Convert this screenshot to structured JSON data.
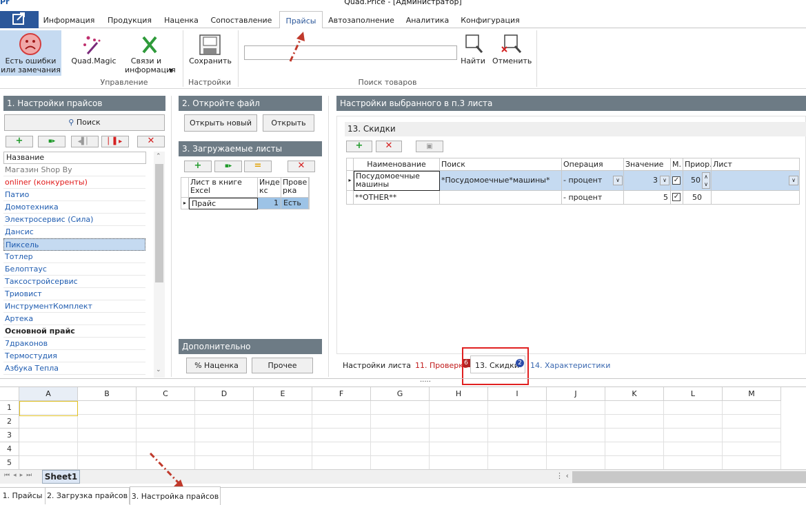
{
  "window": {
    "title": "Quad.Price - [Администратор]",
    "app_logo": "Pr"
  },
  "ribbon_tabs": [
    "Информация",
    "Продукция",
    "Наценка",
    "Сопоставление",
    "Прайсы",
    "Автозаполнение",
    "Аналитика",
    "Конфигурация"
  ],
  "ribbon_active_tab": "Прайсы",
  "ribbon": {
    "errors_button": "Есть ошибки или замечания",
    "quadmagic_button": "Quad.Magic",
    "links_button": "Связи и информация",
    "group_manage": "Управление",
    "save_button": "Сохранить",
    "group_settings": "Настройки",
    "search_value": "",
    "find_button": "Найти",
    "cancel_button": "Отменить",
    "group_search": "Поиск товаров"
  },
  "panel1": {
    "header": "1. Настройки прайсов",
    "search_button": "Поиск",
    "column_header": "Название",
    "items": [
      {
        "name": "Магазин Shop By",
        "style": "gray"
      },
      {
        "name": "onliner (конкуренты)",
        "style": "red"
      },
      {
        "name": "Патио",
        "style": "blue"
      },
      {
        "name": "Домотехника",
        "style": "blue"
      },
      {
        "name": "Электросервис (Сила)",
        "style": "blue"
      },
      {
        "name": "Дансис",
        "style": "blue"
      },
      {
        "name": "Пиксель",
        "style": "selected"
      },
      {
        "name": "Тотлер",
        "style": "blue"
      },
      {
        "name": "Белоптаус",
        "style": "blue"
      },
      {
        "name": "Таксостройсервис",
        "style": "blue"
      },
      {
        "name": "Триовист",
        "style": "blue"
      },
      {
        "name": "ИнструментКомплект",
        "style": "blue"
      },
      {
        "name": "Артека",
        "style": "blue"
      },
      {
        "name": "Основной прайс",
        "style": "bold"
      },
      {
        "name": "7драконов",
        "style": "blue"
      },
      {
        "name": "Термостудия",
        "style": "blue"
      },
      {
        "name": "Азбука Тепла",
        "style": "blue"
      }
    ]
  },
  "panel2": {
    "header": "2. Откройте файл",
    "open_new_button": "Открыть новый",
    "open_button": "Открыть"
  },
  "panel3": {
    "header": "3. Загружаемые листы",
    "columns": [
      "Лист в книге Excel",
      "Индекс",
      "Проверка"
    ],
    "column_labels_display": [
      "Лист в книге Excel",
      "Инде\nкс",
      "Прове\nрка"
    ],
    "rows": [
      {
        "sheet": "Прайс",
        "index": "1",
        "check": "Есть"
      }
    ]
  },
  "additional": {
    "header": "Дополнительно",
    "markup_button": "Наценка",
    "other_button": "Прочее"
  },
  "sheet_settings": {
    "header": "Настройки выбранного в п.3 листа",
    "discounts_header": "13. Скидки",
    "columns": [
      "Наименование",
      "Поиск",
      "Операция",
      "Значение",
      "М.",
      "Приор.",
      "Лист"
    ],
    "rows": [
      {
        "name": "Посудомоечные машины",
        "search": "*Посудомоечные*машины*",
        "operation": "- процент",
        "value": "3",
        "m": true,
        "priority": "50",
        "sheet": ""
      },
      {
        "name": "**OTHER**",
        "search": "",
        "operation": "- процент",
        "value": "5",
        "m": true,
        "priority": "50",
        "sheet": ""
      }
    ],
    "tabs": [
      {
        "label": "Настройки листа",
        "badge": ""
      },
      {
        "label": "11. Проверка",
        "badge": "6"
      },
      {
        "label": "13. Скидки",
        "badge": "2"
      },
      {
        "label": "14. Характеристики",
        "badge": ""
      }
    ],
    "active_tab": "13. Скидки"
  },
  "spreadsheet": {
    "columns": [
      "A",
      "B",
      "C",
      "D",
      "E",
      "F",
      "G",
      "H",
      "I",
      "J",
      "K",
      "L",
      "M"
    ],
    "rows": [
      "1",
      "2",
      "3",
      "4",
      "5"
    ],
    "sheet_tab": "Sheet1",
    "splitter": "....."
  },
  "bottom_tabs": [
    "1. Прайсы",
    "2. Загрузка прайсов",
    "3. Настройка прайсов"
  ],
  "bottom_active_tab": "3. Настройка прайсов",
  "colors": {
    "accent": "#2b579a",
    "panel_header": "#6d7b85",
    "selection": "#c5daf1",
    "highlight_box": "#e02020",
    "arrow": "#c0392b",
    "badge_red": "#b22222",
    "badge_blue": "#2a4aa8"
  }
}
